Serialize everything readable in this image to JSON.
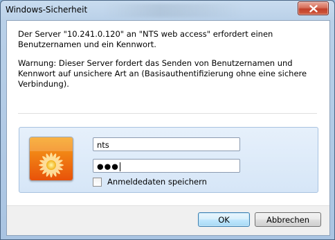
{
  "window": {
    "title": "Windows-Sicherheit",
    "close_icon": "close-x-icon"
  },
  "message": {
    "line1": "Der Server \"10.241.0.120\" an \"NTS web access\" erfordert einen Benutzernamen und ein Kennwort.",
    "warning": "Warnung: Dieser Server fordert das Senden von Benutzernamen und Kennwort auf unsichere Art an (Basisauthentifizierung ohne eine sichere Verbindung)."
  },
  "credentials": {
    "avatar_icon": "user-tile-flower-icon",
    "username_value": "nts",
    "password_mask": "●●●",
    "remember_label": "Anmeldedaten speichern",
    "remember_checked": false
  },
  "buttons": {
    "ok_label": "OK",
    "cancel_label": "Abbrechen"
  },
  "colors": {
    "close_button": "#c2402a",
    "panel_bg": "#dce9f8",
    "ok_border": "#3c7fb1"
  }
}
